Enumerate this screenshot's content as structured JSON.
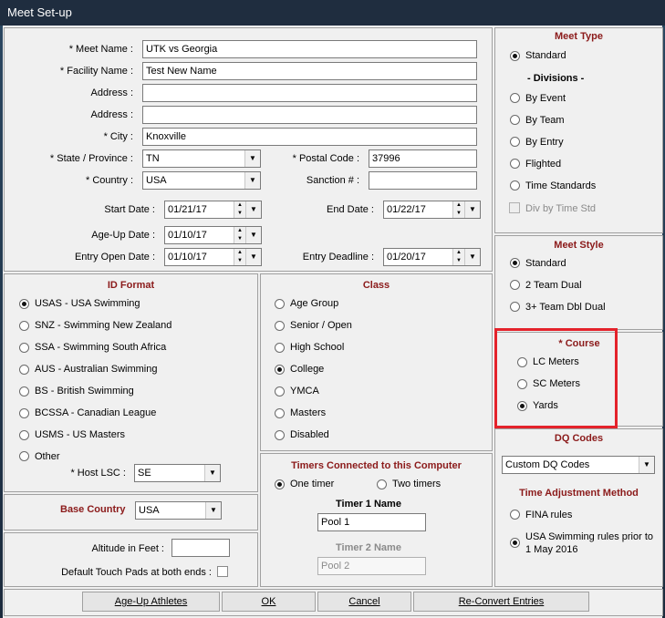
{
  "window": {
    "title": "Meet Set-up"
  },
  "meet_info": {
    "meet_name_label": "* Meet Name :",
    "meet_name": "UTK vs Georgia",
    "facility_label": "* Facility Name :",
    "facility": "Test New Name",
    "address1_label": "Address :",
    "address1": "",
    "address2_label": "Address :",
    "address2": "",
    "city_label": "* City :",
    "city": "Knoxville",
    "state_label": "* State / Province :",
    "state": "TN",
    "postal_label": "* Postal Code :",
    "postal": "37996",
    "country_label": "* Country :",
    "country": "USA",
    "sanction_label": "Sanction # :",
    "sanction": "",
    "start_label": "Start Date :",
    "start": "01/21/17",
    "end_label": "End Date :",
    "end": "01/22/17",
    "ageup_label": "Age-Up Date :",
    "ageup": "01/10/17",
    "entry_open_label": "Entry Open Date :",
    "entry_open": "01/10/17",
    "deadline_label": "Entry Deadline :",
    "deadline": "01/20/17"
  },
  "meet_type": {
    "title": "Meet Type",
    "standard": "Standard",
    "divisions": "- Divisions -",
    "by_event": "By Event",
    "by_team": "By Team",
    "by_entry": "By Entry",
    "flighted": "Flighted",
    "time_standards": "Time Standards",
    "div_by_time": "Div by Time Std"
  },
  "meet_style": {
    "title": "Meet Style",
    "standard": "Standard",
    "two_team": "2 Team Dual",
    "three_team": "3+ Team Dbl Dual"
  },
  "course": {
    "title": "* Course",
    "lc": "LC Meters",
    "sc": "SC Meters",
    "yards": "Yards"
  },
  "id_format": {
    "title": "ID Format",
    "usas": "USAS - USA Swimming",
    "snz": "SNZ - Swimming New Zealand",
    "ssa": "SSA - Swimming South Africa",
    "aus": "AUS - Australian Swimming",
    "bs": "BS - British Swimming",
    "bcssa": "BCSSA - Canadian League",
    "usms": "USMS - US Masters",
    "other": "Other",
    "host_lsc_label": "* Host LSC :",
    "host_lsc": "SE"
  },
  "class": {
    "title": "Class",
    "age_group": "Age Group",
    "senior_open": "Senior / Open",
    "high_school": "High School",
    "college": "College",
    "ymca": "YMCA",
    "masters": "Masters",
    "disabled": "Disabled"
  },
  "timers": {
    "title": "Timers Connected to this Computer",
    "one": "One timer",
    "two": "Two timers",
    "t1_label": "Timer 1 Name",
    "t1": "Pool 1",
    "t2_label": "Timer 2 Name",
    "t2": "Pool 2"
  },
  "dq": {
    "title": "DQ Codes",
    "value": "Custom DQ Codes"
  },
  "time_adj": {
    "title": "Time Adjustment Method",
    "fina": "FINA rules",
    "usa_line1": "USA Swimming rules prior to",
    "usa_line2": "1 May 2016"
  },
  "base_country": {
    "label": "Base Country",
    "value": "USA"
  },
  "misc": {
    "altitude_label": "Altitude in Feet :",
    "altitude": "",
    "touchpads_label": "Default Touch Pads at both ends :"
  },
  "buttons": {
    "ageup": "Age-Up Athletes",
    "ok": "OK",
    "cancel": "Cancel",
    "reconvert": "Re-Convert Entries"
  }
}
